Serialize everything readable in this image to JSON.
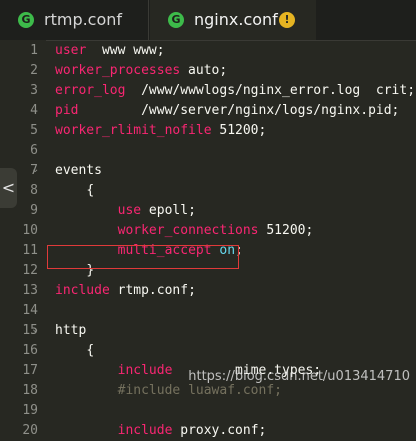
{
  "tabs": [
    {
      "label": "rtmp.conf",
      "icon": "file-type-icon",
      "active": false
    },
    {
      "label": "nginx.conf",
      "icon": "file-type-icon",
      "active": true,
      "badge": "!"
    }
  ],
  "icon_glyphs": {
    "file": "G"
  },
  "colors": {
    "background": "#272822",
    "directive": "#f92672",
    "comment": "#75715e",
    "keyword": "#66d9ef",
    "highlight_box": "#e03a3a",
    "file_icon": "#3dbb4a",
    "warning_badge": "#e6b422"
  },
  "side_handle": "<",
  "line_numbers": [
    "1",
    "2",
    "3",
    "4",
    "5",
    "6",
    "7",
    "8",
    "9",
    "10",
    "11",
    "12",
    "13",
    "14",
    "15",
    "16",
    "17",
    "18",
    "19",
    "20"
  ],
  "lines": [
    {
      "indent": "",
      "key": "user",
      "rest": "  www www;"
    },
    {
      "indent": "",
      "key": "worker_processes",
      "rest": " auto;"
    },
    {
      "indent": "",
      "key": "error_log",
      "rest": "  /www/wwwlogs/nginx_error.log  crit;"
    },
    {
      "indent": "",
      "key": "pid",
      "rest": "        /www/server/nginx/logs/nginx.pid;"
    },
    {
      "indent": "",
      "key": "worker_rlimit_nofile",
      "rest": " 51200;"
    },
    {
      "indent": "",
      "key": "",
      "rest": ""
    },
    {
      "indent": "",
      "key": "",
      "rest": "events"
    },
    {
      "indent": "    ",
      "key": "",
      "rest": "{"
    },
    {
      "indent": "        ",
      "key": "use",
      "rest": " epoll;"
    },
    {
      "indent": "        ",
      "key": "worker_connections",
      "rest": " 51200;"
    },
    {
      "indent": "        ",
      "key": "multi_accept",
      "rest": " ",
      "kw": "on",
      "tail": ";"
    },
    {
      "indent": "    ",
      "key": "",
      "rest": "}"
    },
    {
      "indent": "",
      "key": "include",
      "rest": " rtmp.conf;"
    },
    {
      "indent": "",
      "key": "",
      "rest": ""
    },
    {
      "indent": "",
      "key": "",
      "rest": "http"
    },
    {
      "indent": "    ",
      "key": "",
      "rest": "{"
    },
    {
      "indent": "        ",
      "key": "include",
      "rest": "        mime.types;"
    },
    {
      "indent": "        ",
      "comment": "#include luawaf.conf;"
    },
    {
      "indent": "",
      "key": "",
      "rest": ""
    },
    {
      "indent": "        ",
      "key": "include",
      "rest": " proxy.conf;"
    }
  ],
  "watermark": "https://blog.csdn.net/u013414710"
}
